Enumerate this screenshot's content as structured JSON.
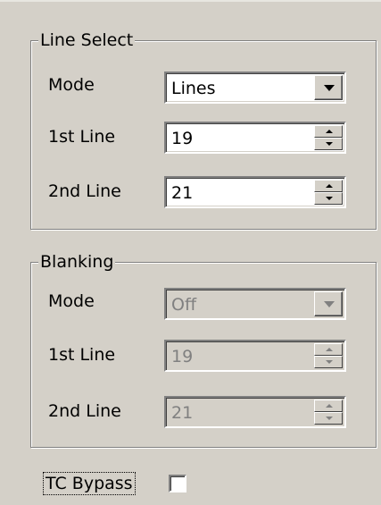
{
  "line_select": {
    "title": "Line Select",
    "mode_label": "Mode",
    "mode_value": "Lines",
    "first_line_label": "1st Line",
    "first_line_value": "19",
    "second_line_label": "2nd Line",
    "second_line_value": "21"
  },
  "blanking": {
    "title": "Blanking",
    "mode_label": "Mode",
    "mode_value": "Off",
    "first_line_label": "1st Line",
    "first_line_value": "19",
    "second_line_label": "2nd Line",
    "second_line_value": "21",
    "disabled": true
  },
  "tc_bypass": {
    "label": "TC Bypass",
    "checked": false
  }
}
